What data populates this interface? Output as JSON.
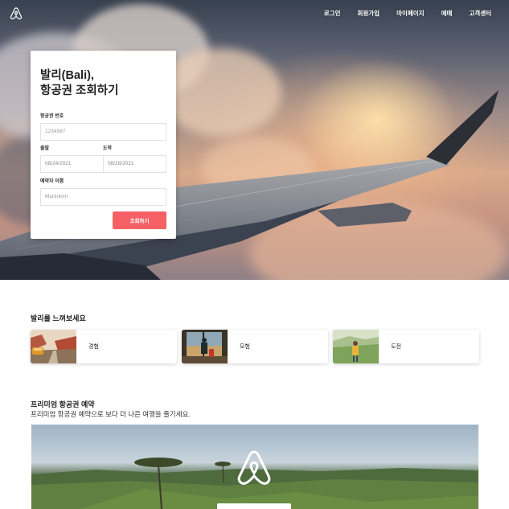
{
  "nav": {
    "items": [
      "로그인",
      "회원가입",
      "마이페이지",
      "예매",
      "고객센터"
    ]
  },
  "search": {
    "title_line1": "발리(Bali),",
    "title_line2": "항공권 조회하기",
    "ticket_label": "항공권 번호",
    "ticket_placeholder": "1234567",
    "depart_label": "출발",
    "depart_value": "08/24/2021",
    "arrive_label": "도착",
    "arrive_value": "08/28/2021",
    "name_label": "예약자 이름",
    "name_placeholder": "Martinkim",
    "submit_label": "조회하기"
  },
  "feel": {
    "title": "발리를 느껴보세요",
    "tiles": [
      {
        "label": "경험",
        "icon": "car-canyon-photo"
      },
      {
        "label": "모험",
        "icon": "traveler-window-photo"
      },
      {
        "label": "도전",
        "icon": "hiker-field-photo"
      }
    ]
  },
  "premium": {
    "title": "프리미엄 항공권 예약",
    "subtitle": "프리미엄 항공권 예약으로 보다 더 나은 여행을 즐기세요."
  },
  "colors": {
    "accent": "#f56165",
    "text": "#222222"
  }
}
